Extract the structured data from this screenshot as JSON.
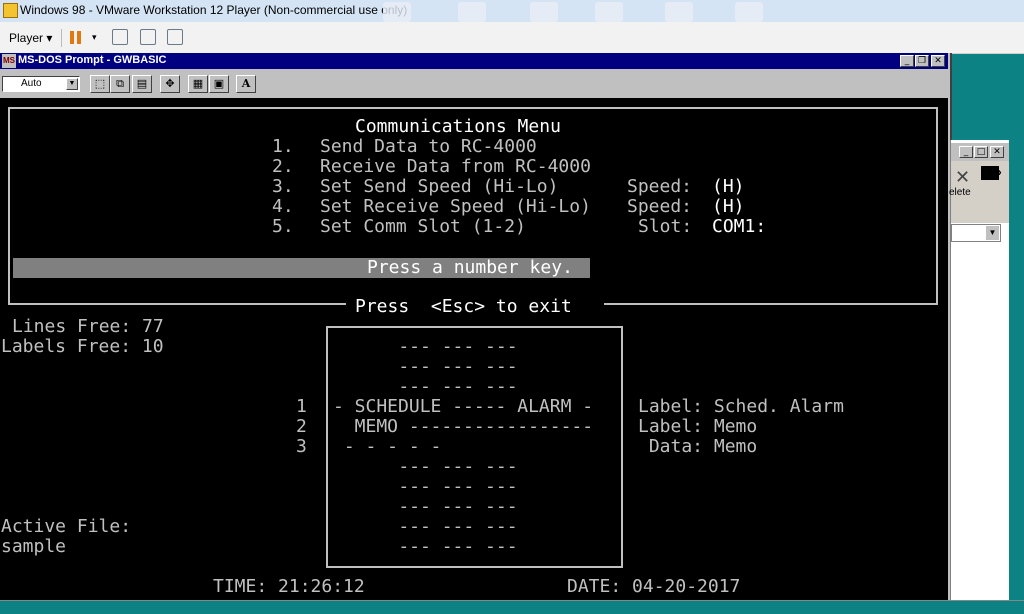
{
  "host": {
    "title": "Windows 98 - VMware Workstation 12 Player (Non-commercial use only)",
    "player_label": "Player ▾"
  },
  "dos_window": {
    "title": "MS-DOS Prompt - GWBASIC",
    "font_value": "Auto",
    "font_button": "A"
  },
  "console": {
    "menu_title": "Communications Menu",
    "menu_items": [
      {
        "num": "1.",
        "label": "Send Data to RC-4000",
        "field": "",
        "value": ""
      },
      {
        "num": "2.",
        "label": "Receive Data from RC-4000",
        "field": "",
        "value": ""
      },
      {
        "num": "3.",
        "label": "Set Send Speed (Hi-Lo)",
        "field": "Speed:",
        "value": "(H)"
      },
      {
        "num": "4.",
        "label": "Set Receive Speed (Hi-Lo)",
        "field": "Speed:",
        "value": "(H)"
      },
      {
        "num": "5.",
        "label": "Set Comm Slot (1-2)",
        "field": "Slot:",
        "value": "COM1:"
      }
    ],
    "prompt": "Press a number key.",
    "exit_hint": "Press  <Esc> to exit",
    "lines_free": "Lines Free: 77",
    "labels_free": "Labels Free: 10",
    "active_file_label": "Active File:",
    "active_file": "sample",
    "time": "TIME: 21:26:12",
    "date": "DATE: 04-20-2017",
    "memory_rows": [
      {
        "num": "",
        "text": "    --- --- ---"
      },
      {
        "num": "",
        "text": "    --- --- ---"
      },
      {
        "num": "",
        "text": "    --- --- ---"
      },
      {
        "num": "1",
        "text": "- SCHEDULE ----- ALARM -"
      },
      {
        "num": "2",
        "text": "  MEMO -----------------"
      },
      {
        "num": "3",
        "text": " - - - - -"
      },
      {
        "num": "",
        "text": "    --- --- ---"
      },
      {
        "num": "",
        "text": "    --- --- ---"
      },
      {
        "num": "",
        "text": "    --- --- ---"
      },
      {
        "num": "",
        "text": "    --- --- ---"
      },
      {
        "num": "",
        "text": "    --- --- ---"
      }
    ],
    "memory_labels": [
      "Label: Sched. Alarm",
      "Label: Memo",
      " Data: Memo"
    ]
  },
  "side_window": {
    "toolbar_label": "elete",
    "chevron": "»"
  }
}
